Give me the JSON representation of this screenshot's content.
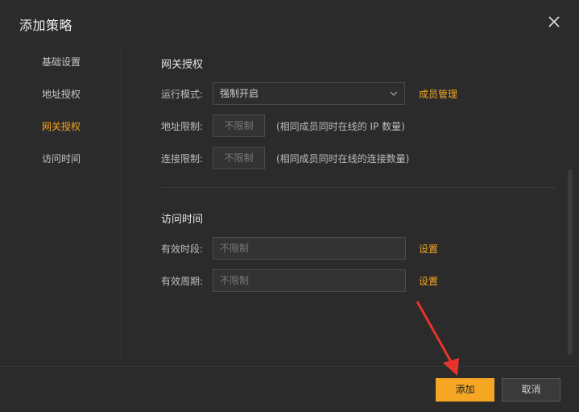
{
  "dialog": {
    "title": "添加策略"
  },
  "nav": {
    "items": [
      {
        "label": "基础设置"
      },
      {
        "label": "地址授权"
      },
      {
        "label": "网关授权"
      },
      {
        "label": "访问时间"
      }
    ],
    "active_index": 2
  },
  "gateway": {
    "section_title": "网关授权",
    "mode_label": "运行模式:",
    "mode_value": "强制开启",
    "members_link": "成员管理",
    "addr_limit_label": "地址限制:",
    "addr_limit_value": "不限制",
    "addr_limit_hint": "(相同成员同时在线的 IP 数量)",
    "conn_limit_label": "连接限制:",
    "conn_limit_value": "不限制",
    "conn_limit_hint": "(相同成员同时在线的连接数量)"
  },
  "access_time": {
    "section_title": "访问时间",
    "period_label": "有效时段:",
    "period_placeholder": "不限制",
    "period_link": "设置",
    "cycle_label": "有效周期:",
    "cycle_placeholder": "不限制",
    "cycle_link": "设置"
  },
  "footer": {
    "add_label": "添加",
    "cancel_label": "取消"
  },
  "colors": {
    "accent": "#f5a623",
    "background": "#2b2b2b",
    "annotation_arrow": "#e8322c"
  }
}
